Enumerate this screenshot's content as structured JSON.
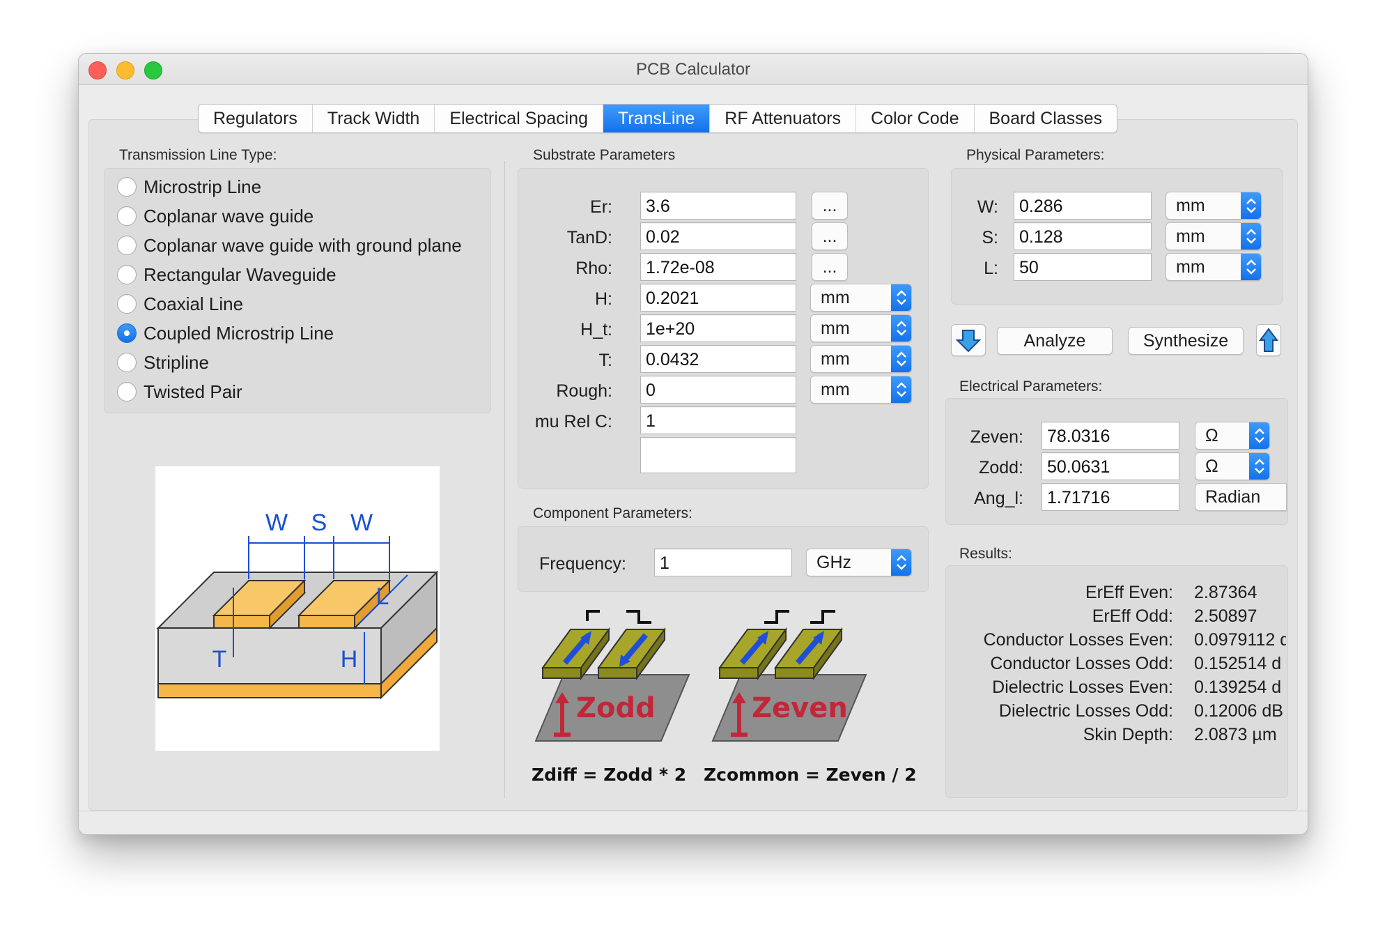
{
  "window": {
    "title": "PCB Calculator"
  },
  "tabs": [
    "Regulators",
    "Track Width",
    "Electrical Spacing",
    "TransLine",
    "RF Attenuators",
    "Color Code",
    "Board Classes"
  ],
  "active_tab": "TransLine",
  "line_type": {
    "label": "Transmission Line Type:",
    "options": [
      "Microstrip Line",
      "Coplanar wave guide",
      "Coplanar wave guide with ground plane",
      "Rectangular Waveguide",
      "Coaxial Line",
      "Coupled Microstrip Line",
      "Stripline",
      "Twisted Pair"
    ],
    "selected": "Coupled Microstrip Line"
  },
  "diagram": {
    "labels": {
      "w1": "W",
      "s": "S",
      "w2": "W",
      "l": "L",
      "t": "T",
      "h": "H"
    }
  },
  "substrate": {
    "label": "Substrate Parameters",
    "er": {
      "label": "Er:",
      "value": "3.6",
      "button": "..."
    },
    "tand": {
      "label": "TanD:",
      "value": "0.02",
      "button": "..."
    },
    "rho": {
      "label": "Rho:",
      "value": "1.72e-08",
      "button": "..."
    },
    "h": {
      "label": "H:",
      "value": "0.2021",
      "unit": "mm"
    },
    "h_t": {
      "label": "H_t:",
      "value": "1e+20",
      "unit": "mm"
    },
    "t": {
      "label": "T:",
      "value": "0.0432",
      "unit": "mm"
    },
    "rough": {
      "label": "Rough:",
      "value": "0",
      "unit": "mm"
    },
    "mu_rel_c": {
      "label": "mu Rel C:",
      "value": "1"
    },
    "extra": {
      "value": ""
    }
  },
  "component": {
    "label": "Component Parameters:",
    "frequency": {
      "label": "Frequency:",
      "value": "1",
      "unit": "GHz"
    }
  },
  "illustrations": {
    "odd_label": "Zodd",
    "even_label": "Zeven",
    "formula_diff": "Zdiff = Zodd * 2",
    "formula_common": "Zcommon = Zeven / 2"
  },
  "physical": {
    "label": "Physical Parameters:",
    "w": {
      "label": "W:",
      "value": "0.286",
      "unit": "mm"
    },
    "s": {
      "label": "S:",
      "value": "0.128",
      "unit": "mm"
    },
    "l": {
      "label": "L:",
      "value": "50",
      "unit": "mm"
    }
  },
  "actions": {
    "analyze": "Analyze",
    "synthesize": "Synthesize"
  },
  "electrical": {
    "label": "Electrical Parameters:",
    "zeven": {
      "label": "Zeven:",
      "value": "78.0316",
      "unit": "Ω"
    },
    "zodd": {
      "label": "Zodd:",
      "value": "50.0631",
      "unit": "Ω"
    },
    "ang": {
      "label": "Ang_l:",
      "value": "1.71716",
      "unit": "Radian"
    }
  },
  "results": {
    "label": "Results:",
    "rows": [
      {
        "label": "ErEff Even:",
        "value": "2.87364"
      },
      {
        "label": "ErEff Odd:",
        "value": "2.50897"
      },
      {
        "label": "Conductor Losses Even:",
        "value": "0.0979112 d"
      },
      {
        "label": "Conductor Losses Odd:",
        "value": "0.152514 d"
      },
      {
        "label": "Dielectric Losses Even:",
        "value": "0.139254 d"
      },
      {
        "label": "Dielectric Losses Odd:",
        "value": "0.12006 dB"
      },
      {
        "label": "Skin Depth:",
        "value": "2.0873 µm"
      }
    ]
  },
  "colors": {
    "accent": "#1a7cf3",
    "trace": "#f5b74a",
    "arrow_blue": "#1f4fd8",
    "label_red": "#c0283a"
  }
}
